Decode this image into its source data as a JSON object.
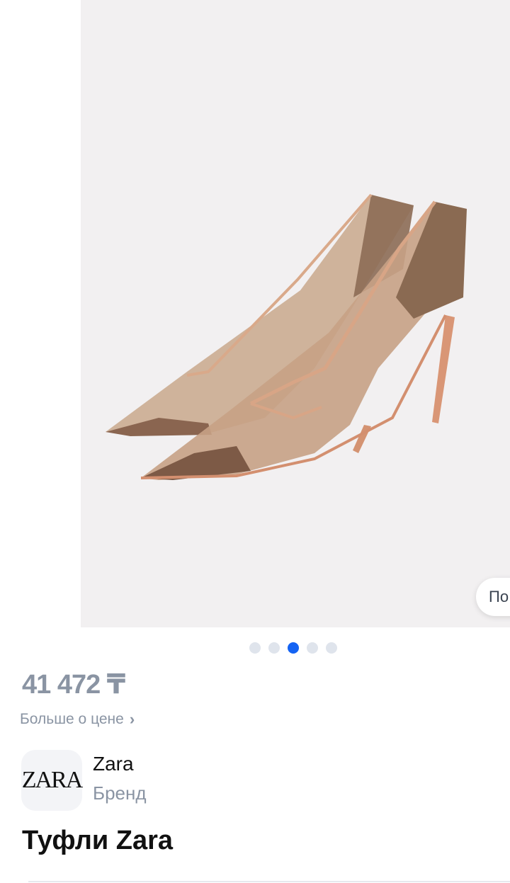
{
  "product": {
    "price": "41 472 ₸",
    "more_price_label": "Больше о цене",
    "title": "Туфли Zara",
    "ask_chip_label": "По"
  },
  "gallery": {
    "image_count": 5,
    "active_index": 2,
    "image_alt": "mesh pointed pumps"
  },
  "brand": {
    "logo_text": "ZARA",
    "name": "Zara",
    "subtitle": "Бренд"
  },
  "icons": {
    "chevron": "chevron-right-icon"
  },
  "colors": {
    "accent": "#1463f3",
    "dot_inactive": "#dfe4ec",
    "muted_text": "#8a94a3"
  }
}
